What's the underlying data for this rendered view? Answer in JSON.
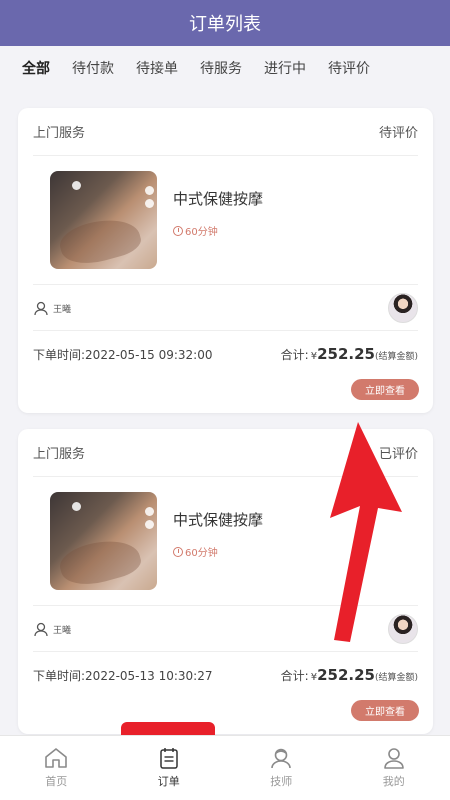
{
  "header": {
    "title": "订单列表"
  },
  "tabs": [
    {
      "label": "全部",
      "active": true
    },
    {
      "label": "待付款",
      "active": false
    },
    {
      "label": "待接单",
      "active": false
    },
    {
      "label": "待服务",
      "active": false
    },
    {
      "label": "进行中",
      "active": false
    },
    {
      "label": "待评价",
      "active": false
    }
  ],
  "orders": [
    {
      "category": "上门服务",
      "status": "待评价",
      "service_name": "中式保健按摩",
      "duration": "60分钟",
      "technician": "王曦",
      "order_time": "下单时间:2022-05-15 09:32:00",
      "total_label": "合计:",
      "currency": "¥",
      "amount": "252.25",
      "amount_note": "(结算金额)",
      "action": "立即查看"
    },
    {
      "category": "上门服务",
      "status": "已评价",
      "service_name": "中式保健按摩",
      "duration": "60分钟",
      "technician": "王曦",
      "order_time": "下单时间:2022-05-13 10:30:27",
      "total_label": "合计:",
      "currency": "¥",
      "amount": "252.25",
      "amount_note": "(结算金额)",
      "action": "立即查看"
    }
  ],
  "tabbar": [
    {
      "label": "首页",
      "icon": "home-icon",
      "active": false
    },
    {
      "label": "订单",
      "icon": "order-icon",
      "active": true
    },
    {
      "label": "技师",
      "icon": "technician-icon",
      "active": false
    },
    {
      "label": "我的",
      "icon": "profile-icon",
      "active": false
    }
  ],
  "colors": {
    "header": "#6a68ad",
    "accent": "#d27a6c",
    "annotation": "#e8202a"
  }
}
